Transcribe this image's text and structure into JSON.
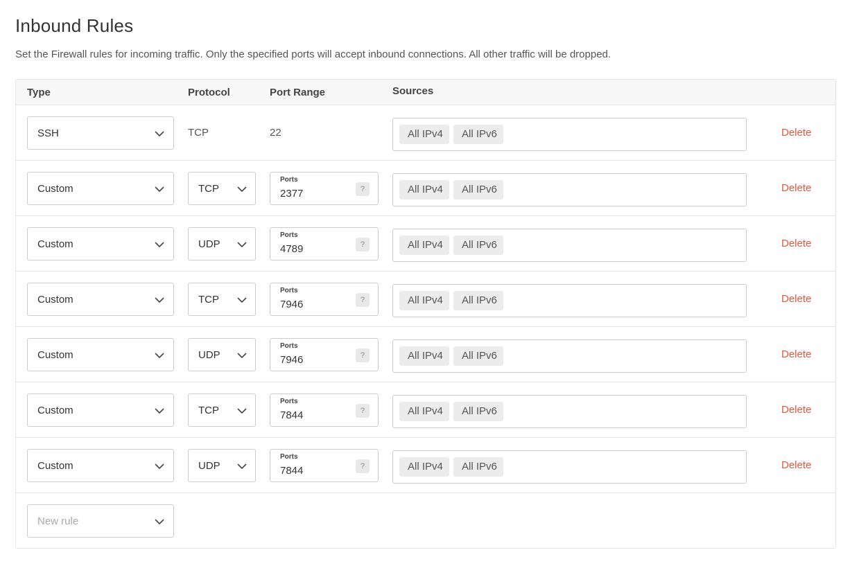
{
  "title": "Inbound Rules",
  "description": "Set the Firewall rules for incoming traffic. Only the specified ports will accept inbound connections. All other traffic will be dropped.",
  "columns": {
    "type": "Type",
    "protocol": "Protocol",
    "port_range": "Port Range",
    "sources": "Sources"
  },
  "ports_label": "Ports",
  "help_glyph": "?",
  "delete_label": "Delete",
  "rules": [
    {
      "type": "SSH",
      "protocol": "TCP",
      "ports": "22",
      "sources": [
        "All IPv4",
        "All IPv6"
      ]
    },
    {
      "type": "Custom",
      "protocol": "TCP",
      "ports": "2377",
      "sources": [
        "All IPv4",
        "All IPv6"
      ]
    },
    {
      "type": "Custom",
      "protocol": "UDP",
      "ports": "4789",
      "sources": [
        "All IPv4",
        "All IPv6"
      ]
    },
    {
      "type": "Custom",
      "protocol": "TCP",
      "ports": "7946",
      "sources": [
        "All IPv4",
        "All IPv6"
      ]
    },
    {
      "type": "Custom",
      "protocol": "UDP",
      "ports": "7946",
      "sources": [
        "All IPv4",
        "All IPv6"
      ]
    },
    {
      "type": "Custom",
      "protocol": "TCP",
      "ports": "7844",
      "sources": [
        "All IPv4",
        "All IPv6"
      ]
    },
    {
      "type": "Custom",
      "protocol": "UDP",
      "ports": "7844",
      "sources": [
        "All IPv4",
        "All IPv6"
      ]
    }
  ],
  "new_rule": {
    "placeholder": "New rule"
  },
  "icons": {
    "dropdown": "chevron-down-icon"
  },
  "colors": {
    "delete": "#e8533d",
    "tag_bg": "#ececec",
    "border": "#cccccc"
  }
}
